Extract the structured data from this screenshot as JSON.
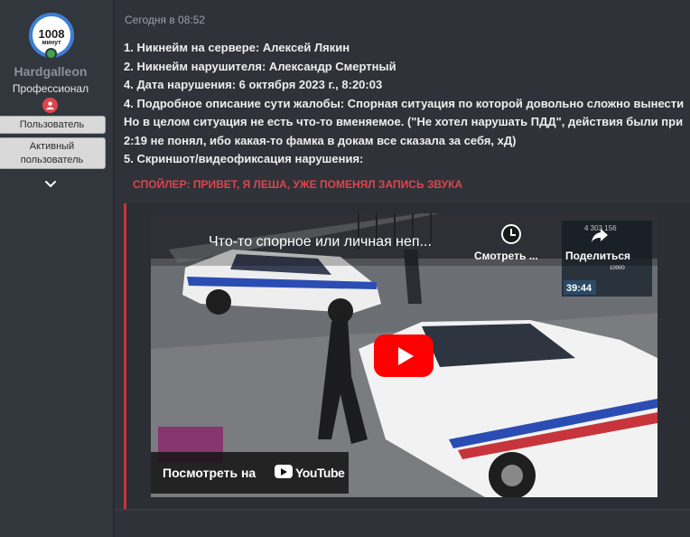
{
  "user": {
    "avatar_number": "1008",
    "avatar_unit": "минут",
    "username": "Hardgalleon",
    "title": "Профессионал",
    "badges": [
      "Пользователь",
      "Активный пользователь"
    ],
    "accent": "#3c7ed6"
  },
  "post": {
    "timestamp": "Сегодня в 08:52",
    "lines": [
      "1. Никнейм на сервере: Алексей Лякин",
      "2. Никнейм нарушителя: Александр Смертный",
      "4. Дата нарушения: 6 октября 2023 г., 8:20:03",
      "4. Подробное описание сути жалобы: Спорная ситуация по которой довольно сложно вынести",
      "Но в целом ситуация не есть что-то вменяемое. (\"Не хотел нарушать ПДД\", действия были при",
      "2:19 не понял, ибо какая-то фамка в докам все сказала за себя, хД)",
      "5. Скриншот/видеофиксация нарушения:"
    ],
    "spoiler_label": "СПОЙЛЕР: ПРИВЕТ, Я ЛЕША, УЖЕ ПОМЕНЯЛ ЗАПИСЬ ЗВУКА",
    "spoiler_color": "#e0444b"
  },
  "video": {
    "title": "Что-то спорное или личная неп...",
    "watch_later": "Смотреть ...",
    "share": "Поделиться",
    "watch_on": "Посмотреть на",
    "youtube": "YouTube",
    "hud_money": "4 303 156",
    "hud_cash": "10000",
    "hud_timer": "39:44"
  }
}
